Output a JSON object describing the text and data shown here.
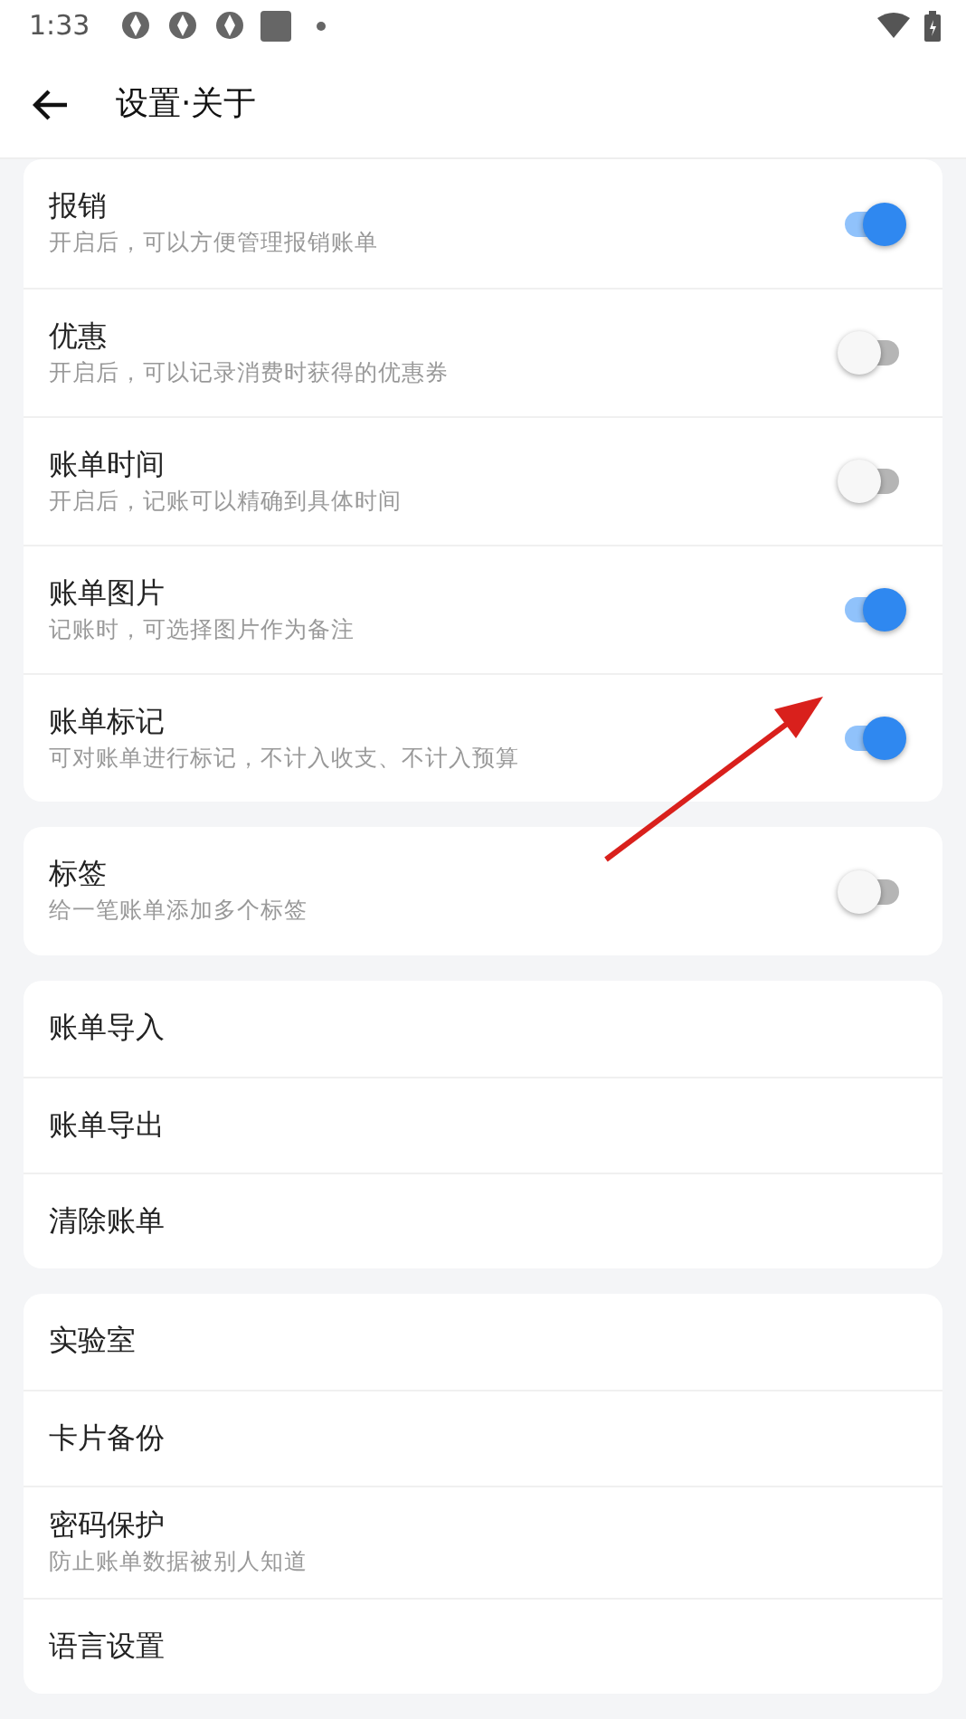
{
  "status_bar": {
    "time": "1:33"
  },
  "app_bar": {
    "title": "设置·关于"
  },
  "groups": [
    {
      "items": [
        {
          "kind": "toggle",
          "title": "报销",
          "subtitle": "开启后，可以方便管理报销账单",
          "on": true
        },
        {
          "kind": "toggle",
          "title": "优惠",
          "subtitle": "开启后，可以记录消费时获得的优惠券",
          "on": false
        },
        {
          "kind": "toggle",
          "title": "账单时间",
          "subtitle": "开启后，记账可以精确到具体时间",
          "on": false
        },
        {
          "kind": "toggle",
          "title": "账单图片",
          "subtitle": "记账时，可选择图片作为备注",
          "on": true
        },
        {
          "kind": "toggle",
          "title": "账单标记",
          "subtitle": "可对账单进行标记，不计入收支、不计入预算",
          "on": true
        }
      ]
    },
    {
      "items": [
        {
          "kind": "toggle",
          "title": "标签",
          "subtitle": "给一笔账单添加多个标签",
          "on": false
        }
      ]
    },
    {
      "items": [
        {
          "kind": "link",
          "title": "账单导入"
        },
        {
          "kind": "link",
          "title": "账单导出"
        },
        {
          "kind": "link",
          "title": "清除账单"
        }
      ]
    },
    {
      "items": [
        {
          "kind": "link",
          "title": "实验室"
        },
        {
          "kind": "link",
          "title": "卡片备份"
        },
        {
          "kind": "link",
          "title": "密码保护",
          "subtitle": "防止账单数据被别人知道"
        },
        {
          "kind": "link",
          "title": "语言设置"
        }
      ]
    }
  ]
}
